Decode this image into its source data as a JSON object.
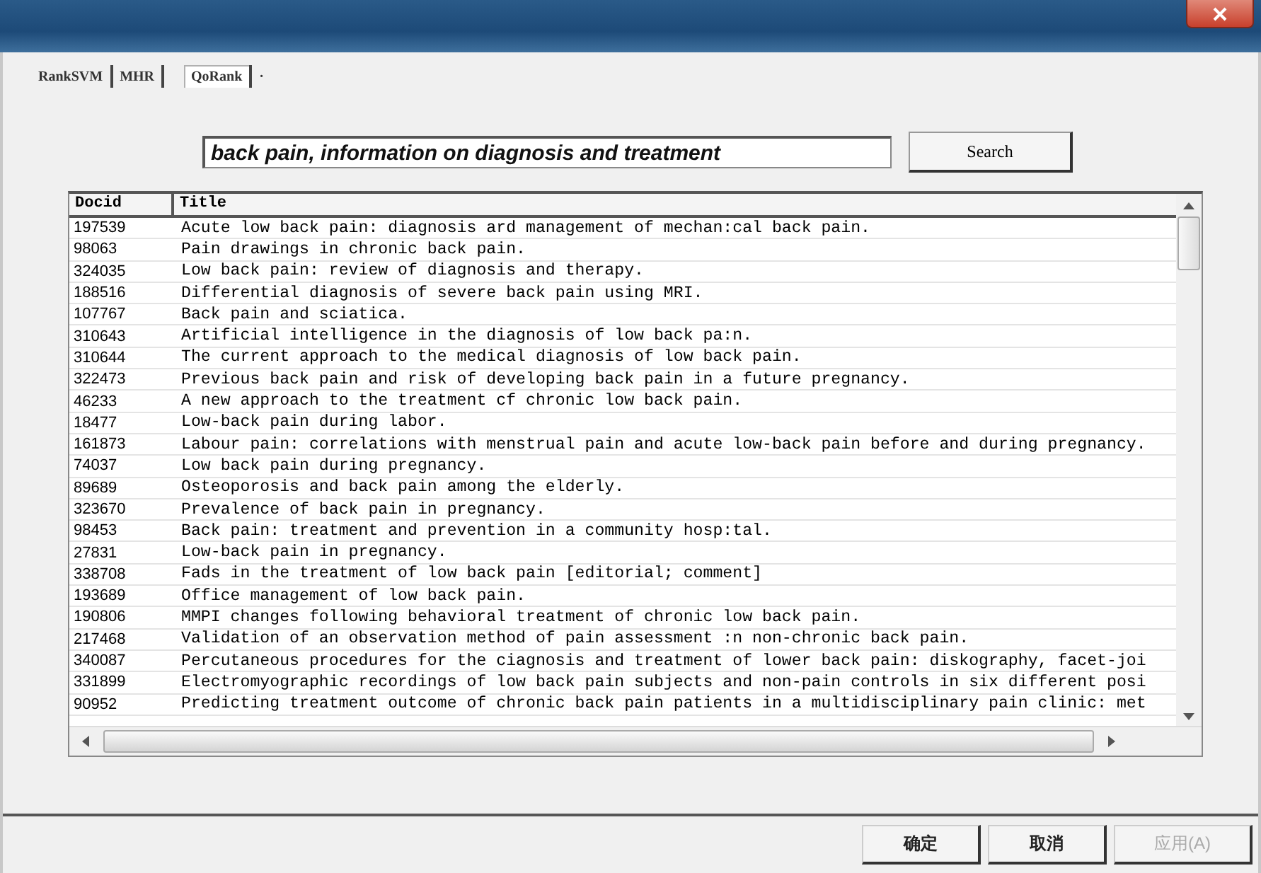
{
  "tabs": [
    {
      "label": "RankSVM",
      "selected": false
    },
    {
      "label": "MHR",
      "selected": false
    },
    {
      "label": "QoRank",
      "selected": true
    },
    {
      "label": "·",
      "selected": false
    }
  ],
  "search": {
    "value": "back pain, information on diagnosis and treatment",
    "button": "Search"
  },
  "table": {
    "columns": [
      "Docid",
      "Title"
    ],
    "rows": [
      [
        "197539",
        "Acute low back pain: diagnosis ard management of mechan:cal back pain."
      ],
      [
        "98063",
        "Pain drawings in chronic back pain."
      ],
      [
        "324035",
        "Low back pain: review of diagnosis and therapy."
      ],
      [
        "188516",
        "Differential diagnosis of severe back pain using MRI."
      ],
      [
        "107767",
        "Back pain and sciatica."
      ],
      [
        "310643",
        "Artificial intelligence in the diagnosis of low back pa:n."
      ],
      [
        "310644",
        "The current approach to the medical diagnosis of low back pain."
      ],
      [
        "322473",
        "Previous back pain and risk of developing back pain in a future pregnancy."
      ],
      [
        "46233",
        "A new approach to the treatment cf chronic low back pain."
      ],
      [
        "18477",
        "Low-back pain during labor."
      ],
      [
        "161873",
        "Labour pain: correlations with menstrual pain and acute low-back pain before and during pregnancy."
      ],
      [
        "74037",
        "Low back pain during pregnancy."
      ],
      [
        "89689",
        "Osteoporosis and back pain among the elderly."
      ],
      [
        "323670",
        "Prevalence of back pain in pregnancy."
      ],
      [
        "98453",
        "Back pain: treatment and prevention in a community hosp:tal."
      ],
      [
        "27831",
        "Low-back pain in pregnancy."
      ],
      [
        "338708",
        "Fads in the treatment of low back pain [editorial; comment]"
      ],
      [
        "193689",
        "Office management of low back pain."
      ],
      [
        "190806",
        "MMPI changes following behavioral treatment of chronic low back pain."
      ],
      [
        "217468",
        "Validation of an observation method of pain assessment :n non-chronic back pain."
      ],
      [
        "340087",
        "Percutaneous procedures for the ciagnosis and treatment of lower back pain: diskography, facet-joi"
      ],
      [
        "331899",
        "Electromyographic recordings of low back pain subjects and non-pain controls in six different posi"
      ],
      [
        "90952",
        "Predicting treatment outcome of chronic back pain patients in a multidisciplinary pain clinic: met"
      ]
    ]
  },
  "buttons": [
    {
      "label": "确定",
      "disabled": false
    },
    {
      "label": "取消",
      "disabled": false
    },
    {
      "label": "应用(A)",
      "disabled": true
    }
  ]
}
